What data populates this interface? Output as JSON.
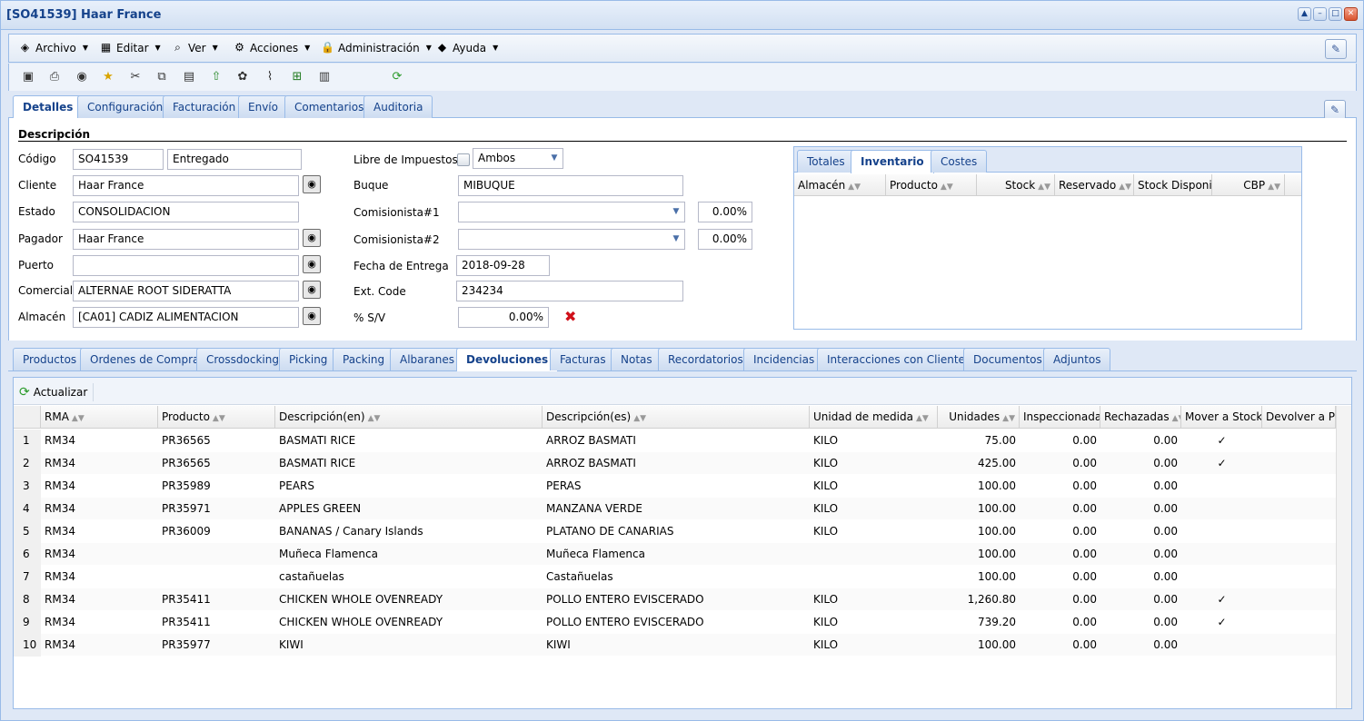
{
  "window": {
    "title": "[SO41539] Haar France"
  },
  "menu": [
    {
      "label": "Archivo",
      "icon": "archive-icon"
    },
    {
      "label": "Editar",
      "icon": "edit-icon"
    },
    {
      "label": "Ver",
      "icon": "view-icon"
    },
    {
      "label": "Acciones",
      "icon": "actions-icon"
    },
    {
      "label": "Administración",
      "icon": "lock-icon"
    },
    {
      "label": "Ayuda",
      "icon": "help-book-icon"
    }
  ],
  "toolbar_icons": [
    "save-icon",
    "print-icon",
    "export-icon",
    "favorite-icon",
    "cut-icon",
    "copy-icon",
    "paste-icon",
    "import-icon",
    "attach-group-icon",
    "clip-icon",
    "excel-icon",
    "report-icon",
    "refresh-icon"
  ],
  "main_tabs": [
    "Detalles",
    "Configuración",
    "Facturación",
    "Envío",
    "Comentarios",
    "Auditoria"
  ],
  "details": {
    "section_title": "Descripción",
    "left": [
      {
        "label": "Código",
        "value": "SO41539",
        "value2": "Entregado"
      },
      {
        "label": "Cliente",
        "value": "Haar France"
      },
      {
        "label": "Estado",
        "value": "CONSOLIDACION"
      },
      {
        "label": "Pagador",
        "value": "Haar France"
      },
      {
        "label": "Puerto",
        "value": ""
      },
      {
        "label": "Comercial",
        "value": "ALTERNAE ROOT SIDERATTA"
      },
      {
        "label": "Almacén",
        "value": "[CA01] CADIZ ALIMENTACION"
      }
    ],
    "right": {
      "libre_label": "Libre de Impuestos",
      "libre_combo": "Ambos",
      "buque_label": "Buque",
      "buque_value": "MIBUQUE",
      "com1_label": "Comisionista#1",
      "com1_pct": "0.00%",
      "com2_label": "Comisionista#2",
      "com2_pct": "0.00%",
      "fecha_label": "Fecha de Entrega",
      "fecha_value": "2018-09-28",
      "ext_label": "Ext. Code",
      "ext_value": "234234",
      "sv_label": "% S/V",
      "sv_value": "0.00%"
    }
  },
  "inventory": {
    "tabs": [
      "Totales",
      "Inventario",
      "Costes"
    ],
    "columns": [
      "Almacén",
      "Producto",
      "Stock",
      "Reservado",
      "Stock Disponibl",
      "CBP"
    ]
  },
  "bottom_tabs": [
    "Productos",
    "Ordenes de Compra",
    "Crossdocking",
    "Picking",
    "Packing",
    "Albaranes",
    "Devoluciones",
    "Facturas",
    "Notas",
    "Recordatorios",
    "Incidencias",
    "Interacciones con Clientes",
    "Documentos",
    "Adjuntos"
  ],
  "grid": {
    "refresh_label": "Actualizar",
    "columns": [
      "RMA",
      "Producto",
      "Descripción(en)",
      "Descripción(es)",
      "Unidad de medida",
      "Unidades",
      "Inspeccionadas",
      "Rechazadas",
      "Mover a Stock",
      "Devolver a Pro"
    ],
    "rows": [
      [
        "1",
        "RM34",
        "PR36565",
        "BASMATI RICE",
        "ARROZ BASMATI",
        "KILO",
        "75.00",
        "0.00",
        "0.00",
        "✓"
      ],
      [
        "2",
        "RM34",
        "PR36565",
        "BASMATI RICE",
        "ARROZ BASMATI",
        "KILO",
        "425.00",
        "0.00",
        "0.00",
        "✓"
      ],
      [
        "3",
        "RM34",
        "PR35989",
        "PEARS",
        "PERAS",
        "KILO",
        "100.00",
        "0.00",
        "0.00",
        ""
      ],
      [
        "4",
        "RM34",
        "PR35971",
        "APPLES GREEN",
        "MANZANA VERDE",
        "KILO",
        "100.00",
        "0.00",
        "0.00",
        ""
      ],
      [
        "5",
        "RM34",
        "PR36009",
        "BANANAS / Canary Islands",
        "PLATANO DE CANARIAS",
        "KILO",
        "100.00",
        "0.00",
        "0.00",
        ""
      ],
      [
        "6",
        "RM34",
        "",
        "Muñeca Flamenca",
        "Muñeca Flamenca",
        "",
        "100.00",
        "0.00",
        "0.00",
        ""
      ],
      [
        "7",
        "RM34",
        "",
        "castañuelas",
        "Castañuelas",
        "",
        "100.00",
        "0.00",
        "0.00",
        ""
      ],
      [
        "8",
        "RM34",
        "PR35411",
        "CHICKEN WHOLE OVENREADY",
        "POLLO ENTERO EVISCERADO",
        "KILO",
        "1,260.80",
        "0.00",
        "0.00",
        "✓"
      ],
      [
        "9",
        "RM34",
        "PR35411",
        "CHICKEN WHOLE OVENREADY",
        "POLLO ENTERO EVISCERADO",
        "KILO",
        "739.20",
        "0.00",
        "0.00",
        "✓"
      ],
      [
        "10",
        "RM34",
        "PR35977",
        "KIWI",
        "KIWI",
        "KILO",
        "100.00",
        "0.00",
        "0.00",
        ""
      ]
    ]
  }
}
